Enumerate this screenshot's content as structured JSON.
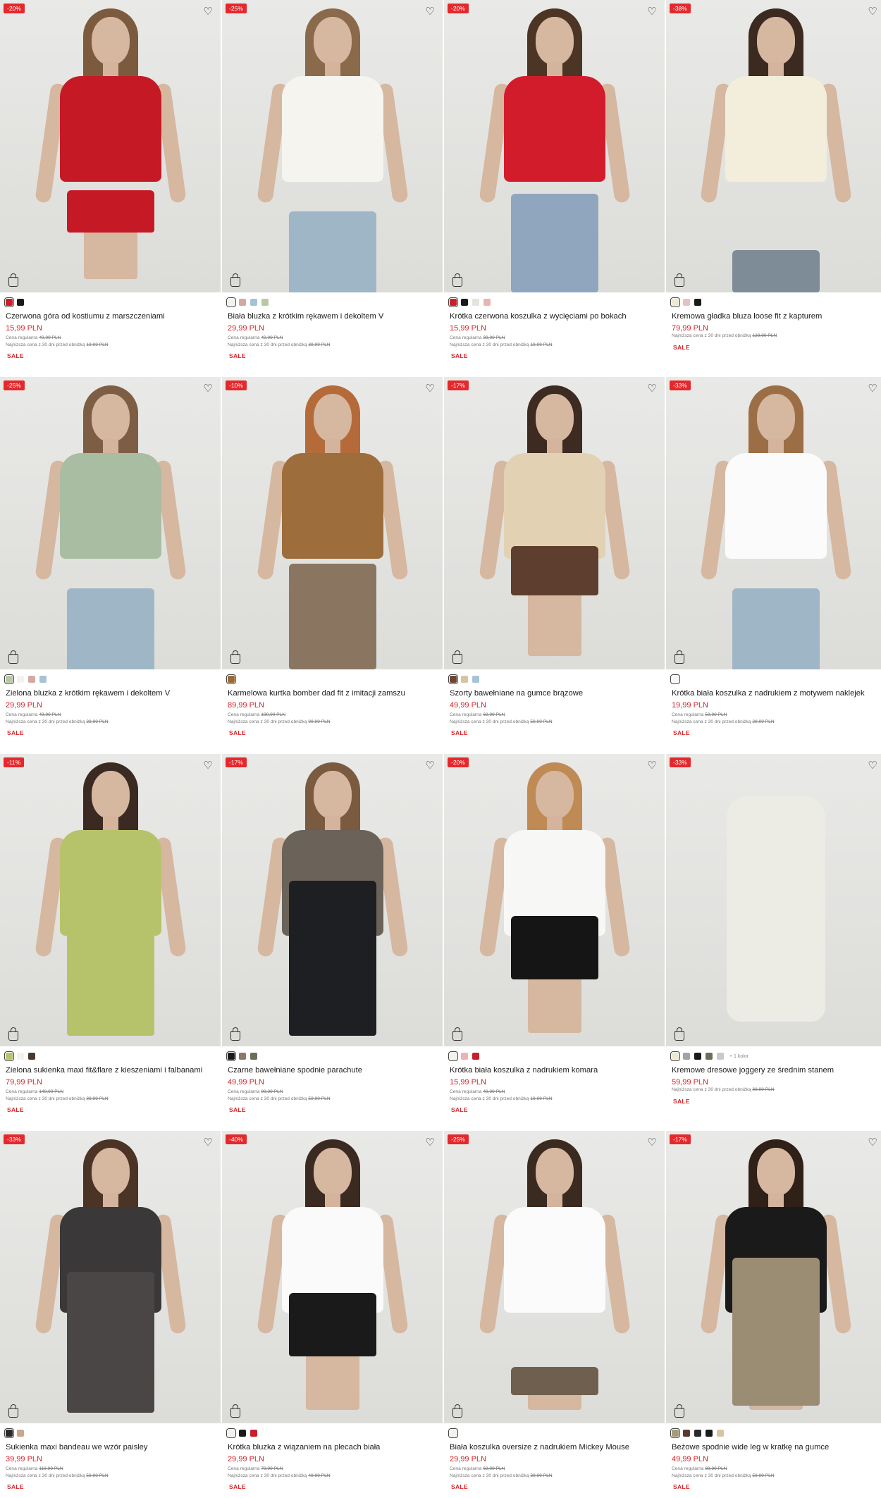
{
  "products": [
    {
      "discount": "-20%",
      "name": "Czerwona góra od kostiumu z marszczeniami",
      "price": "15,99 PLN",
      "regular_label": "Cena regularna",
      "regular_price": "49,99 PLN",
      "lowest_label": "Najniższa cena z 30 dni przed obniżką",
      "lowest_price": "19,99 PLN",
      "sale_label": "SALE",
      "colors": [
        "#c8202a",
        "#1a1a1a"
      ],
      "more_colors": "",
      "style": {
        "top": "#c51a26",
        "bottom": "#c51a26",
        "hair": "#7b5a3e",
        "bottomH": 60,
        "bottomTop": 270
      }
    },
    {
      "discount": "-25%",
      "name": "Biała bluzka z krótkim rękawem i dekoltem V",
      "price": "29,99 PLN",
      "regular_label": "Cena regularna",
      "regular_price": "49,99 PLN",
      "lowest_label": "Najniższa cena z 30 dni przed obniżką",
      "lowest_price": "39,99 PLN",
      "sale_label": "SALE",
      "colors": [
        "#f3f2ee",
        "#d4a9a3",
        "#a7c3d6",
        "#b9c7a6"
      ],
      "more_colors": "",
      "style": {
        "top": "#f5f4ef",
        "bottom": "#9fb6c6",
        "hair": "#8a6a4b",
        "bottomH": 120,
        "bottomTop": 300
      }
    },
    {
      "discount": "-20%",
      "name": "Krótka czerwona koszulka z wycięciami po bokach",
      "price": "15,99 PLN",
      "regular_label": "Cena regularna",
      "regular_price": "39,99 PLN",
      "lowest_label": "Najniższa cena z 30 dni przed obniżką",
      "lowest_price": "19,99 PLN",
      "sale_label": "SALE",
      "colors": [
        "#c8202a",
        "#1a1a1a",
        "#e6e2dc",
        "#e8b4b4"
      ],
      "more_colors": "",
      "style": {
        "top": "#d21c2c",
        "bottom": "#8fa6be",
        "hair": "#4d3525",
        "bottomH": 140,
        "bottomTop": 275
      }
    },
    {
      "discount": "-38%",
      "name": "Kremowa gładka bluza loose fit z kapturem",
      "price": "79,99 PLN",
      "regular_label": "",
      "regular_price": "",
      "lowest_label": "Najniższa cena z 30 dni przed obniżką",
      "lowest_price": "129,99 PLN",
      "sale_label": "SALE",
      "colors": [
        "#efe9d3",
        "#e7c1c1",
        "#1a1a1a"
      ],
      "more_colors": "",
      "style": {
        "top": "#f2eedb",
        "bottom": "#7e8c97",
        "hair": "#3b2a20",
        "bottomH": 60,
        "bottomTop": 355
      }
    },
    {
      "discount": "-25%",
      "name": "Zielona bluzka z krótkim rękawem i dekoltem V",
      "price": "29,99 PLN",
      "regular_label": "Cena regularna",
      "regular_price": "49,99 PLN",
      "lowest_label": "Najniższa cena z 30 dni przed obniżką",
      "lowest_price": "39,99 PLN",
      "sale_label": "SALE",
      "colors": [
        "#b9c7a6",
        "#f3f2ee",
        "#d4a9a3",
        "#a7c3d6"
      ],
      "more_colors": "",
      "style": {
        "top": "#a9bda3",
        "bottom": "#9fb6c6",
        "hair": "#7d5e45",
        "bottomH": 120,
        "bottomTop": 300
      }
    },
    {
      "discount": "-10%",
      "name": "Karmelowa kurtka bomber dad fit z imitacji zamszu",
      "price": "89,99 PLN",
      "regular_label": "Cena regularna",
      "regular_price": "199,99 PLN",
      "lowest_label": "Najniższa cena z 30 dni przed obniżką",
      "lowest_price": "99,99 PLN",
      "sale_label": "SALE",
      "colors": [
        "#9a6a35"
      ],
      "more_colors": "",
      "style": {
        "top": "#9d6d3c",
        "bottom": "#8a7660",
        "hair": "#b56a3a",
        "bottomH": 150,
        "bottomTop": 265
      }
    },
    {
      "discount": "-17%",
      "name": "Szorty bawełniane na gumce brązowe",
      "price": "49,99 PLN",
      "regular_label": "Cena regularna",
      "regular_price": "69,99 PLN",
      "lowest_label": "Najniższa cena z 30 dni przed obniżką",
      "lowest_price": "59,99 PLN",
      "sale_label": "SALE",
      "colors": [
        "#6a4632",
        "#d6c5a4",
        "#a7c3d6"
      ],
      "more_colors": "",
      "style": {
        "top": "#e2d2b3",
        "bottom": "#5e3e2e",
        "hair": "#3d2a20",
        "bottomH": 70,
        "bottomTop": 240
      }
    },
    {
      "discount": "-33%",
      "name": "Krótka biała koszulka z nadrukiem z motywem naklejek",
      "price": "19,99 PLN",
      "regular_label": "Cena regularna",
      "regular_price": "59,99 PLN",
      "lowest_label": "Najniższa cena z 30 dni przed obniżką",
      "lowest_price": "29,99 PLN",
      "sale_label": "SALE",
      "colors": [
        "#f7f7f7"
      ],
      "more_colors": "",
      "style": {
        "top": "#fbfbfb",
        "bottom": "#9fb6c6",
        "hair": "#9c6e45",
        "bottomH": 120,
        "bottomTop": 300
      }
    },
    {
      "discount": "-11%",
      "name": "Zielona sukienka maxi fit&flare z kieszeniami i falbanami",
      "price": "79,99 PLN",
      "regular_label": "Cena regularna",
      "regular_price": "149,99 PLN",
      "lowest_label": "Najniższa cena z 30 dni przed obniżką",
      "lowest_price": "89,99 PLN",
      "sale_label": "SALE",
      "colors": [
        "#b5c56a",
        "#f3f2ee",
        "#4a3a2e"
      ],
      "more_colors": "",
      "style": {
        "top": "#b7c36a",
        "bottom": "#b7c36a",
        "hair": "#3a2a22",
        "bottomH": 200,
        "bottomTop": 200
      }
    },
    {
      "discount": "-17%",
      "name": "Czarne bawełniane spodnie parachute",
      "price": "49,99 PLN",
      "regular_label": "Cena regularna",
      "regular_price": "99,99 PLN",
      "lowest_label": "Najniższa cena z 30 dni przed obniżką",
      "lowest_price": "59,99 PLN",
      "sale_label": "SALE",
      "colors": [
        "#1a1a1a",
        "#8a7a66",
        "#6b6f5a"
      ],
      "more_colors": "",
      "style": {
        "top": "#6b6259",
        "bottom": "#1e1f22",
        "hair": "#7a5b40",
        "bottomH": 220,
        "bottomTop": 180
      }
    },
    {
      "discount": "-20%",
      "name": "Krótka biała koszulka z nadrukiem komara",
      "price": "15,99 PLN",
      "regular_label": "Cena regularna",
      "regular_price": "49,99 PLN",
      "lowest_label": "Najniższa cena z 30 dni przed obniżką",
      "lowest_price": "19,99 PLN",
      "sale_label": "SALE",
      "colors": [
        "#f3f2ee",
        "#e8b4b4",
        "#c8202a"
      ],
      "more_colors": "",
      "style": {
        "top": "#f7f7f5",
        "bottom": "#151515",
        "hair": "#c08a55",
        "bottomH": 90,
        "bottomTop": 230
      }
    },
    {
      "discount": "-33%",
      "name": "Kremowe dresowe joggery ze średnim stanem",
      "price": "59,99 PLN",
      "regular_label": "",
      "regular_price": "",
      "lowest_label": "Najniższa cena z 30 dni przed obniżką",
      "lowest_price": "89,99 PLN",
      "sale_label": "SALE",
      "colors": [
        "#efe9d3",
        "#a3a3a3",
        "#1a1a1a",
        "#6b6f5a",
        "#c9c9c9"
      ],
      "more_colors": "+ 1 kolor",
      "style": {
        "top": "",
        "bottom": "#ecebe4",
        "hair": "",
        "bottomH": 0,
        "bottomTop": 0
      }
    },
    {
      "discount": "-33%",
      "name": "Sukienka maxi bandeau we wzór paisley",
      "price": "39,99 PLN",
      "regular_label": "Cena regularna",
      "regular_price": "119,99 PLN",
      "lowest_label": "Najniższa cena z 30 dni przed obniżką",
      "lowest_price": "59,99 PLN",
      "sale_label": "SALE",
      "colors": [
        "#2a2a2a",
        "#c9a889"
      ],
      "more_colors": "",
      "style": {
        "top": "#3a3838",
        "bottom": "#4a4646",
        "hair": "#4b3326",
        "bottomH": 200,
        "bottomTop": 200
      }
    },
    {
      "discount": "-40%",
      "name": "Krótka bluzka z wiązaniem na plecach biała",
      "price": "29,99 PLN",
      "regular_label": "Cena regularna",
      "regular_price": "79,99 PLN",
      "lowest_label": "Najniższa cena z 30 dni przed obniżką",
      "lowest_price": "49,99 PLN",
      "sale_label": "SALE",
      "colors": [
        "#f3f2ee",
        "#1a1a1a",
        "#c8202a"
      ],
      "more_colors": "",
      "style": {
        "top": "#fafafa",
        "bottom": "#1a1a1a",
        "hair": "#3b2a22",
        "bottomH": 90,
        "bottomTop": 230
      }
    },
    {
      "discount": "-25%",
      "name": "Biała koszulka oversize z nadrukiem Mickey Mouse",
      "price": "29,99 PLN",
      "regular_label": "Cena regularna",
      "regular_price": "69,99 PLN",
      "lowest_label": "Najniższa cena z 30 dni przed obniżką",
      "lowest_price": "39,99 PLN",
      "sale_label": "SALE",
      "colors": [
        "#f3f2ee"
      ],
      "more_colors": "",
      "style": {
        "top": "#fbfbfb",
        "bottom": "#6f5f4f",
        "hair": "#3b2a20",
        "bottomH": 40,
        "bottomTop": 335
      }
    },
    {
      "discount": "-17%",
      "name": "Beżowe spodnie wide leg w kratkę na gumce",
      "price": "49,99 PLN",
      "regular_label": "Cena regularna",
      "regular_price": "89,99 PLN",
      "lowest_label": "Najniższa cena z 30 dni przed obniżką",
      "lowest_price": "59,99 PLN",
      "sale_label": "SALE",
      "colors": [
        "#a49a7c",
        "#5a3a2e",
        "#2a2a2a",
        "#1a1a1a",
        "#d6c5a4"
      ],
      "more_colors": "",
      "style": {
        "top": "#1a1a1a",
        "bottom": "#9a8d74",
        "hair": "#2f2018",
        "bottomH": 210,
        "bottomTop": 180
      }
    }
  ]
}
